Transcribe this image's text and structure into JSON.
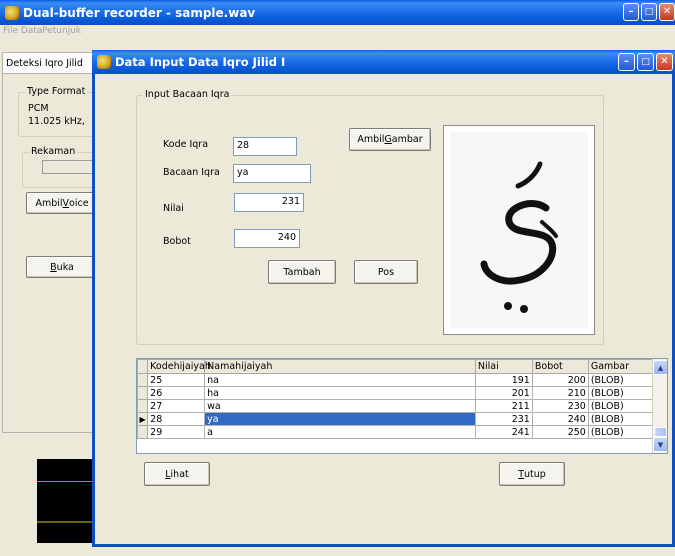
{
  "main_window": {
    "title": "Dual-buffer recorder - sample.wav",
    "menu": [
      "File Data",
      "Petunjuk"
    ],
    "tab": "Deteksi Iqro Jilid",
    "type_format": {
      "caption": "Type Format",
      "line1": "PCM",
      "line2": "11.025 kHz,"
    },
    "rekaman": {
      "caption": "Rekaman"
    },
    "ambil_voice": {
      "pre": "Ambil ",
      "key": "V",
      "post": "oice"
    },
    "buka": {
      "pre": "",
      "key": "B",
      "post": "uka"
    }
  },
  "dialog": {
    "title": "Data Input Data Iqro Jilid I",
    "group_caption": "Input Bacaan Iqra",
    "fields": {
      "kode_label": "Kode Iqra",
      "kode_value": "28",
      "bacaan_label": "Bacaan Iqra",
      "bacaan_value": "ya",
      "nilai_label": "Nilai",
      "nilai_value": "231",
      "bobot_label": "Bobot",
      "bobot_value": "240"
    },
    "buttons": {
      "ambil_gambar": {
        "pre": "Ambil ",
        "key": "G",
        "post": "ambar"
      },
      "tambah": "Tambah",
      "pos": "Pos",
      "lihat": {
        "pre": "",
        "key": "L",
        "post": "ihat"
      },
      "tutup": {
        "pre": "",
        "key": "T",
        "post": "utup"
      }
    },
    "grid": {
      "columns": [
        "Kodehijaiyah",
        "Namahijaiyah",
        "Nilai",
        "Bobot",
        "Gambar"
      ],
      "rows": [
        {
          "kode": "25",
          "nama": "na",
          "nilai": "191",
          "bobot": "200",
          "gambar": "(BLOB)"
        },
        {
          "kode": "26",
          "nama": "ha",
          "nilai": "201",
          "bobot": "210",
          "gambar": "(BLOB)"
        },
        {
          "kode": "27",
          "nama": "wa",
          "nilai": "211",
          "bobot": "230",
          "gambar": "(BLOB)"
        },
        {
          "kode": "28",
          "nama": "ya",
          "nilai": "231",
          "bobot": "240",
          "gambar": "(BLOB)"
        },
        {
          "kode": "29",
          "nama": "a",
          "nilai": "241",
          "bobot": "250",
          "gambar": "(BLOB)"
        }
      ],
      "selected_row_index": 3
    }
  },
  "colors": {
    "title_blue": "#0c5ad8",
    "selection": "#316ac5",
    "waveform": "#c8c826",
    "waveform_bg": "#000000",
    "cyan_line": "#2bb6c8"
  },
  "icons": [
    "app-icon",
    "minimize-icon",
    "maximize-icon",
    "close-icon",
    "row-pointer-icon",
    "scroll-up-icon",
    "scroll-down-icon"
  ]
}
